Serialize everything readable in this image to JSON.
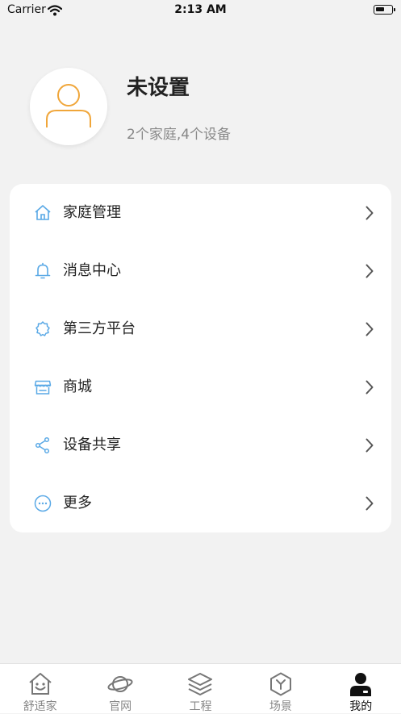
{
  "status_bar": {
    "carrier": "Carrier",
    "time": "2:13 AM",
    "battery_level": 0.6
  },
  "profile": {
    "name": "未设置",
    "summary": "2个家庭,4个设备"
  },
  "colors": {
    "accent_blue": "#5aa9e6",
    "avatar_orange": "#f0a63a",
    "active_tab": "#111111",
    "inactive_tab": "#888888"
  },
  "menu": {
    "items": [
      {
        "label": "家庭管理",
        "icon": "home-icon"
      },
      {
        "label": "消息中心",
        "icon": "bell-icon"
      },
      {
        "label": "第三方平台",
        "icon": "gear-icon"
      },
      {
        "label": "商城",
        "icon": "store-icon"
      },
      {
        "label": "设备共享",
        "icon": "share-icon"
      },
      {
        "label": "更多",
        "icon": "more-icon"
      }
    ]
  },
  "tab_bar": {
    "active": "我的",
    "tabs": [
      {
        "label": "舒适家",
        "icon": "smiley-house-icon"
      },
      {
        "label": "官网",
        "icon": "planet-icon"
      },
      {
        "label": "工程",
        "icon": "layers-icon"
      },
      {
        "label": "场景",
        "icon": "hexagon-icon"
      },
      {
        "label": "我的",
        "icon": "user-icon"
      }
    ]
  }
}
